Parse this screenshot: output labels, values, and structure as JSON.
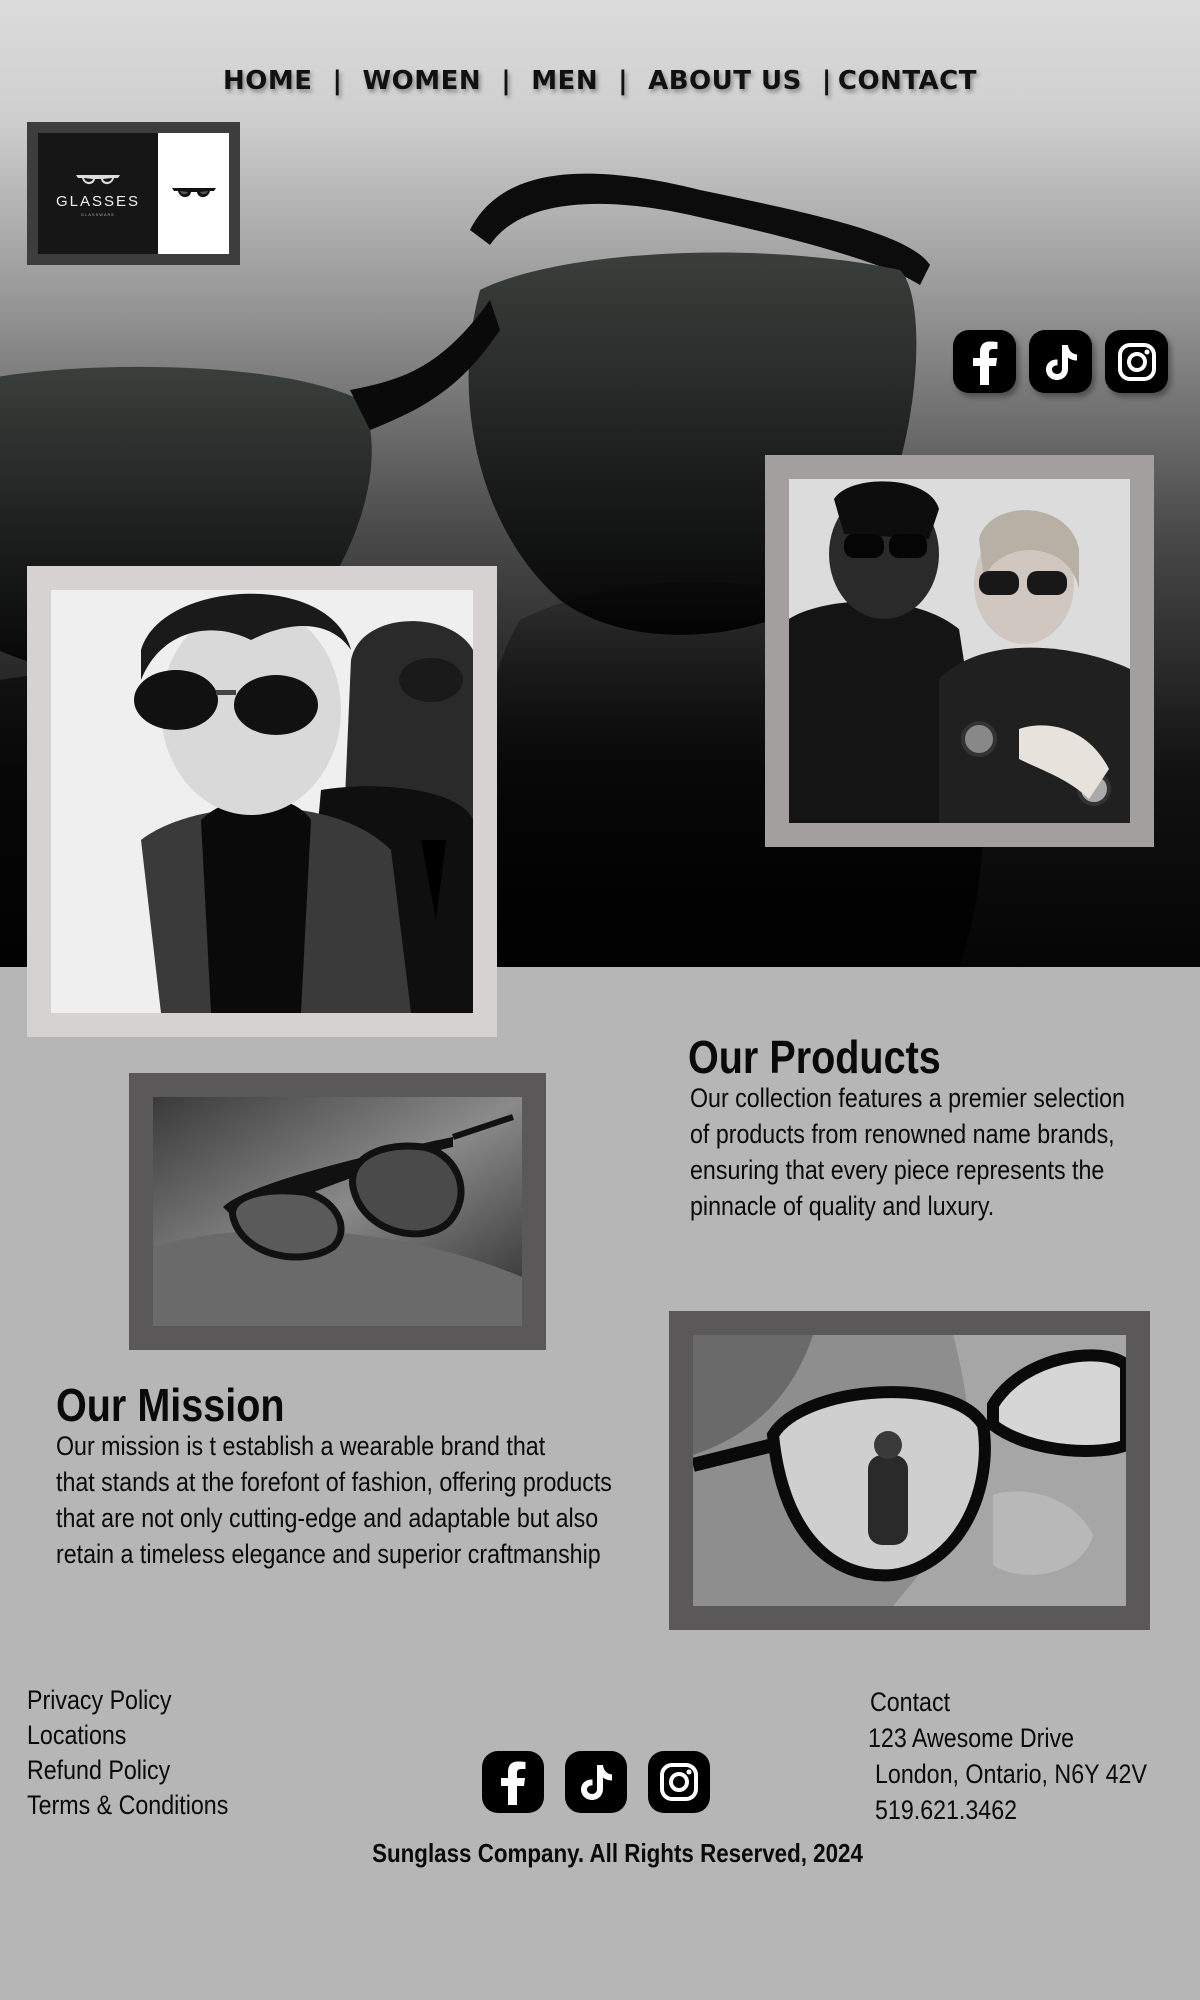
{
  "nav": {
    "items": [
      {
        "label": "HOME"
      },
      {
        "label": "WOMEN"
      },
      {
        "label": "MEN"
      },
      {
        "label": "ABOUT US"
      },
      {
        "label": "CONTACT"
      }
    ],
    "separator": "|"
  },
  "logo": {
    "brand": "GLASSES",
    "tagline": "GLASSWARE"
  },
  "social": {
    "icons": [
      "facebook-icon",
      "tiktok-icon",
      "instagram-icon"
    ]
  },
  "products": {
    "title": "Our Products",
    "lines": [
      "Our collection features a premier selection",
      "of products from renowned name brands,",
      "ensuring that every piece represents the",
      "pinnacle of quality and luxury."
    ]
  },
  "mission": {
    "title": "Our Mission",
    "lines": [
      "Our mission is t establish a wearable brand that",
      "that stands at the forefont of fashion, offering products",
      "that are not only cutting-edge and adaptable but also",
      "retain a timeless elegance and superior craftmanship"
    ]
  },
  "footer": {
    "links": [
      "Privacy Policy",
      "Locations",
      "Refund Policy",
      "Terms & Conditions"
    ],
    "contact": {
      "heading": "Contact",
      "address1": "123 Awesome Drive",
      "address2": "London, Ontario, N6Y 42V",
      "phone": "519.621.3462"
    },
    "copyright": "Sunglass Company. All Rights Reserved, 2024"
  },
  "colors": {
    "page_bg": "#b6b6b6",
    "frame_light": "#a49f9f",
    "frame_dark": "#5a5858",
    "text": "#0a0a0a"
  }
}
